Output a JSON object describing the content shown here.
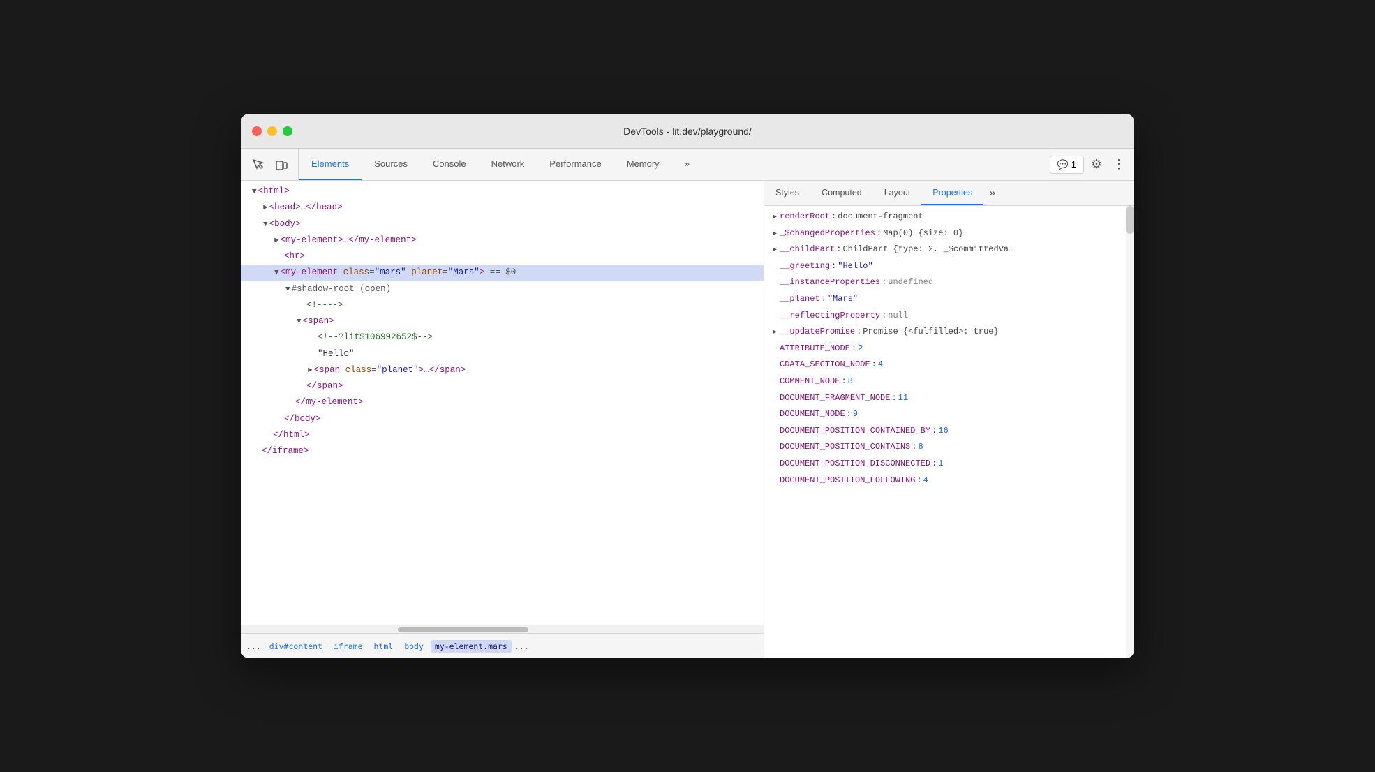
{
  "window": {
    "title": "DevTools - lit.dev/playground/"
  },
  "toolbar": {
    "tabs": [
      {
        "id": "elements",
        "label": "Elements",
        "active": true
      },
      {
        "id": "sources",
        "label": "Sources",
        "active": false
      },
      {
        "id": "console",
        "label": "Console",
        "active": false
      },
      {
        "id": "network",
        "label": "Network",
        "active": false
      },
      {
        "id": "performance",
        "label": "Performance",
        "active": false
      },
      {
        "id": "memory",
        "label": "Memory",
        "active": false
      }
    ],
    "more_label": "»",
    "feedback_label": "💬 1",
    "settings_label": "⚙",
    "kebab_label": "⋮"
  },
  "dom_panel": {
    "lines": [
      {
        "id": 1,
        "indent": "indent-1",
        "content_type": "tag_open",
        "text": "▼ <html>",
        "selected": false
      },
      {
        "id": 2,
        "indent": "indent-2",
        "content_type": "tag_collapsed",
        "text": "► <head>…</head>",
        "selected": false
      },
      {
        "id": 3,
        "indent": "indent-2",
        "content_type": "tag_open",
        "text": "▼ <body>",
        "selected": false
      },
      {
        "id": 4,
        "indent": "indent-3",
        "content_type": "tag_collapsed",
        "text": "► <my-element>…</my-element>",
        "selected": false
      },
      {
        "id": 5,
        "indent": "indent-3",
        "content_type": "tag",
        "text": "<hr>",
        "selected": false
      },
      {
        "id": 6,
        "indent": "indent-3",
        "content_type": "selected",
        "text": "▼ <my-element class=\"mars\" planet=\"Mars\"> == $0",
        "selected": true
      },
      {
        "id": 7,
        "indent": "indent-4",
        "content_type": "shadow",
        "text": "▼ #shadow-root (open)",
        "selected": false
      },
      {
        "id": 8,
        "indent": "indent-5",
        "content_type": "comment",
        "text": "<!----> ",
        "selected": false
      },
      {
        "id": 9,
        "indent": "indent-5",
        "content_type": "tag_open",
        "text": "▼ <span>",
        "selected": false
      },
      {
        "id": 10,
        "indent": "indent-6",
        "content_type": "comment",
        "text": "<!--?lit$106992652$-->",
        "selected": false
      },
      {
        "id": 11,
        "indent": "indent-6",
        "content_type": "text",
        "text": "\"Hello\"",
        "selected": false
      },
      {
        "id": 12,
        "indent": "indent-6",
        "content_type": "tag_collapsed",
        "text": "► <span class=\"planet\">…</span>",
        "selected": false
      },
      {
        "id": 13,
        "indent": "indent-5",
        "content_type": "tag_close",
        "text": "</span>",
        "selected": false
      },
      {
        "id": 14,
        "indent": "indent-4",
        "content_type": "tag_close",
        "text": "</my-element>",
        "selected": false
      },
      {
        "id": 15,
        "indent": "indent-3",
        "content_type": "tag_close",
        "text": "</body>",
        "selected": false
      },
      {
        "id": 16,
        "indent": "indent-2",
        "content_type": "tag_close",
        "text": "</html>",
        "selected": false
      },
      {
        "id": 17,
        "indent": "indent-1",
        "content_type": "tag_close",
        "text": "</iframe>",
        "selected": false
      }
    ],
    "breadcrumb": {
      "dots": "...",
      "items": [
        {
          "label": "div#content",
          "active": false
        },
        {
          "label": "iframe",
          "active": false
        },
        {
          "label": "html",
          "active": false
        },
        {
          "label": "body",
          "active": false
        },
        {
          "label": "my-element.mars",
          "active": true
        }
      ],
      "more": "..."
    }
  },
  "props_panel": {
    "tabs": [
      {
        "id": "styles",
        "label": "Styles",
        "active": false
      },
      {
        "id": "computed",
        "label": "Computed",
        "active": false
      },
      {
        "id": "layout",
        "label": "Layout",
        "active": false
      },
      {
        "id": "properties",
        "label": "Properties",
        "active": true
      }
    ],
    "more_label": "»",
    "properties": [
      {
        "key": "renderRoot",
        "colon": ":",
        "value": "document-fragment",
        "value_type": "obj",
        "expandable": true
      },
      {
        "key": "_$changedProperties",
        "colon": ":",
        "value": "Map(0) {size: 0}",
        "value_type": "obj",
        "expandable": true
      },
      {
        "key": "__childPart",
        "colon": ":",
        "value": "ChildPart {type: 2, _$committedVa…",
        "value_type": "obj",
        "expandable": true
      },
      {
        "key": "__greeting",
        "colon": ":",
        "value": "\"Hello\"",
        "value_type": "str",
        "expandable": false
      },
      {
        "key": "__instanceProperties",
        "colon": ":",
        "value": "undefined",
        "value_type": "null",
        "expandable": false
      },
      {
        "key": "__planet",
        "colon": ":",
        "value": "\"Mars\"",
        "value_type": "str",
        "expandable": false
      },
      {
        "key": "__reflectingProperty",
        "colon": ":",
        "value": "null",
        "value_type": "null",
        "expandable": false
      },
      {
        "key": "__updatePromise",
        "colon": ":",
        "value": "Promise {<fulfilled>: true}",
        "value_type": "obj",
        "expandable": true
      },
      {
        "key": "ATTRIBUTE_NODE",
        "colon": ":",
        "value": "2",
        "value_type": "num",
        "expandable": false
      },
      {
        "key": "CDATA_SECTION_NODE",
        "colon": ":",
        "value": "4",
        "value_type": "num",
        "expandable": false
      },
      {
        "key": "COMMENT_NODE",
        "colon": ":",
        "value": "8",
        "value_type": "num",
        "expandable": false
      },
      {
        "key": "DOCUMENT_FRAGMENT_NODE",
        "colon": ":",
        "value": "11",
        "value_type": "num",
        "expandable": false
      },
      {
        "key": "DOCUMENT_NODE",
        "colon": ":",
        "value": "9",
        "value_type": "num",
        "expandable": false
      },
      {
        "key": "DOCUMENT_POSITION_CONTAINED_BY",
        "colon": ":",
        "value": "16",
        "value_type": "num",
        "expandable": false
      },
      {
        "key": "DOCUMENT_POSITION_CONTAINS",
        "colon": ":",
        "value": "8",
        "value_type": "num",
        "expandable": false
      },
      {
        "key": "DOCUMENT_POSITION_DISCONNECTED",
        "colon": ":",
        "value": "1",
        "value_type": "num",
        "expandable": false
      },
      {
        "key": "DOCUMENT_POSITION_FOLLOWING",
        "colon": ":",
        "value": "4",
        "value_type": "num",
        "expandable": false
      }
    ]
  }
}
